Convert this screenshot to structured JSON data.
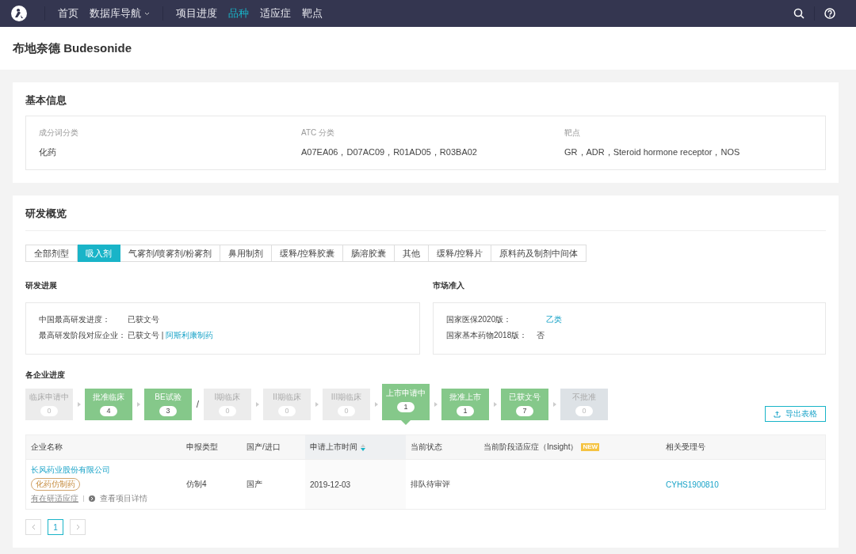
{
  "nav": {
    "groups": [
      [
        {
          "label": "首页",
          "selected": false,
          "dropdown": false
        },
        {
          "label": "数据库导航",
          "selected": false,
          "dropdown": true
        }
      ],
      [
        {
          "label": "项目进度",
          "selected": false,
          "dropdown": false
        },
        {
          "label": "品种",
          "selected": true,
          "dropdown": false
        },
        {
          "label": "适应症",
          "selected": false,
          "dropdown": false
        },
        {
          "label": "靶点",
          "selected": false,
          "dropdown": false
        }
      ]
    ]
  },
  "page_title": "布地奈德 Budesonide",
  "basic_info": {
    "title": "基本信息",
    "fields": [
      {
        "label": "成分词分类",
        "value": "化药"
      },
      {
        "label": "ATC 分类",
        "value": "A07EA06，D07AC09，R01AD05，R03BA02"
      },
      {
        "label": "靶点",
        "value": "GR，ADR，Steroid hormone receptor，NOS"
      }
    ]
  },
  "overview": {
    "title": "研发概览",
    "tabs": [
      {
        "label": "全部剂型",
        "selected": false
      },
      {
        "label": "吸入剂",
        "selected": true
      },
      {
        "label": "气雾剂/喷雾剂/粉雾剂",
        "selected": false
      },
      {
        "label": "鼻用制剂",
        "selected": false
      },
      {
        "label": "缓释/控释胶囊",
        "selected": false
      },
      {
        "label": "肠溶胶囊",
        "selected": false
      },
      {
        "label": "其他",
        "selected": false
      },
      {
        "label": "缓释/控释片",
        "selected": false
      },
      {
        "label": "原料药及制剂中间体",
        "selected": false
      }
    ],
    "progress": {
      "title": "研发进展",
      "rows": [
        {
          "label": "中国最高研发进度：",
          "value": "已获文号"
        },
        {
          "label": "最高研发阶段对应企业：",
          "value": "已获文号 |",
          "link": "阿斯利康制药"
        }
      ]
    },
    "market": {
      "title": "市场准入",
      "rows": [
        {
          "label": "国家医保2020版：",
          "value": "乙类",
          "kind": "link"
        },
        {
          "label": "国家基本药物2018版：",
          "value": "否",
          "kind": "text"
        }
      ]
    },
    "companies": {
      "title": "各企业进度",
      "export_label": "导出表格",
      "stages": [
        {
          "label": "临床申请中",
          "count": "0",
          "kind": "empty",
          "selected": false
        },
        {
          "label": "批准临床",
          "count": "4",
          "kind": "active",
          "selected": false
        },
        {
          "label": "BE试验",
          "count": "3",
          "kind": "active",
          "selected": false,
          "separator": "/"
        },
        {
          "label": "I期临床",
          "count": "0",
          "kind": "empty",
          "selected": false
        },
        {
          "label": "II期临床",
          "count": "0",
          "kind": "empty",
          "selected": false
        },
        {
          "label": "III期临床",
          "count": "0",
          "kind": "empty",
          "selected": false
        },
        {
          "label": "上市申请中",
          "count": "1",
          "kind": "active",
          "selected": true
        },
        {
          "label": "批准上市",
          "count": "1",
          "kind": "active",
          "selected": false
        },
        {
          "label": "已获文号",
          "count": "7",
          "kind": "active",
          "selected": false
        },
        {
          "label": "不批准",
          "count": "0",
          "kind": "rejected",
          "selected": false
        }
      ],
      "table": {
        "columns": [
          {
            "label": "企业名称"
          },
          {
            "label": "申报类型"
          },
          {
            "label": "国产/进口"
          },
          {
            "label": "申请上市时间",
            "sorted": true
          },
          {
            "label": "当前状态"
          },
          {
            "label": "当前阶段适应症（Insight）",
            "badge": "NEW"
          },
          {
            "label": "相关受理号"
          }
        ],
        "rows": [
          {
            "company": "长风药业股份有限公司",
            "tag": "化药仿制药",
            "links": [
              "有在研适应症",
              "查看项目详情"
            ],
            "type": "仿制4",
            "origin": "国产",
            "date": "2019-12-03",
            "status": "排队待审评",
            "indication": "",
            "number": "CYHS1900810"
          }
        ]
      },
      "pagination": {
        "pages": [
          {
            "label": "1",
            "selected": true
          }
        ]
      }
    }
  }
}
